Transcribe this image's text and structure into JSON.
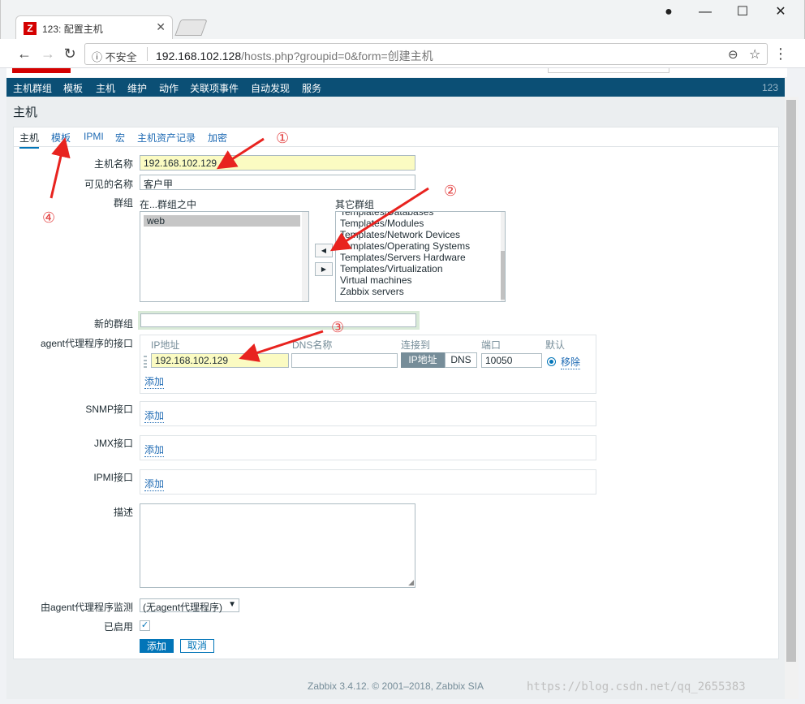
{
  "browser": {
    "tab_title": "123: 配置主机",
    "tab_favicon": "Z",
    "insecure_label": "不安全",
    "url_host": "192.168.102.128",
    "url_path": "/hosts.php?groupid=0&form=创建主机"
  },
  "topnav": {
    "items": [
      "主机群组",
      "模板",
      "主机",
      "维护",
      "动作",
      "关联项事件",
      "自动发现",
      "服务"
    ],
    "active_index": 2,
    "user_number": "123"
  },
  "page": {
    "title": "主机"
  },
  "form_tabs": [
    "主机",
    "模板",
    "IPMI",
    "宏",
    "主机资产记录",
    "加密"
  ],
  "form": {
    "host_name_label": "主机名称",
    "host_name_value": "192.168.102.129",
    "visible_name_label": "可见的名称",
    "visible_name_value": "客户甲",
    "groups_label": "群组",
    "in_groups_label": "在...群组之中",
    "in_groups": [
      "web"
    ],
    "other_groups_label": "其它群组",
    "other_groups": [
      "Templates/Databases",
      "Templates/Modules",
      "Templates/Network Devices",
      "Templates/Operating Systems",
      "Templates/Servers Hardware",
      "Templates/Virtualization",
      "Virtual machines",
      "Zabbix servers"
    ],
    "new_group_label": "新的群组",
    "new_group_value": "",
    "agent_iface_label": "agent代理程序的接口",
    "iface_headers": {
      "ip": "IP地址",
      "dns": "DNS名称",
      "connect": "连接到",
      "port": "端口",
      "default": "默认"
    },
    "agent_ip": "192.168.102.129",
    "agent_dns": "",
    "connect_ip": "IP地址",
    "connect_dns": "DNS",
    "agent_port": "10050",
    "remove_label": "移除",
    "add_label": "添加",
    "snmp_label": "SNMP接口",
    "jmx_label": "JMX接口",
    "ipmi_label": "IPMI接口",
    "description_label": "描述",
    "proxy_label": "由agent代理程序监测",
    "proxy_value": "(无agent代理程序)",
    "enabled_label": "已启用",
    "submit_label": "添加",
    "cancel_label": "取消"
  },
  "footer": {
    "text": "Zabbix 3.4.12. © 2001–2018, Zabbix SIA"
  },
  "watermark": "https://blog.csdn.net/qq_2655383",
  "annotations": [
    "①",
    "②",
    "③",
    "④"
  ]
}
